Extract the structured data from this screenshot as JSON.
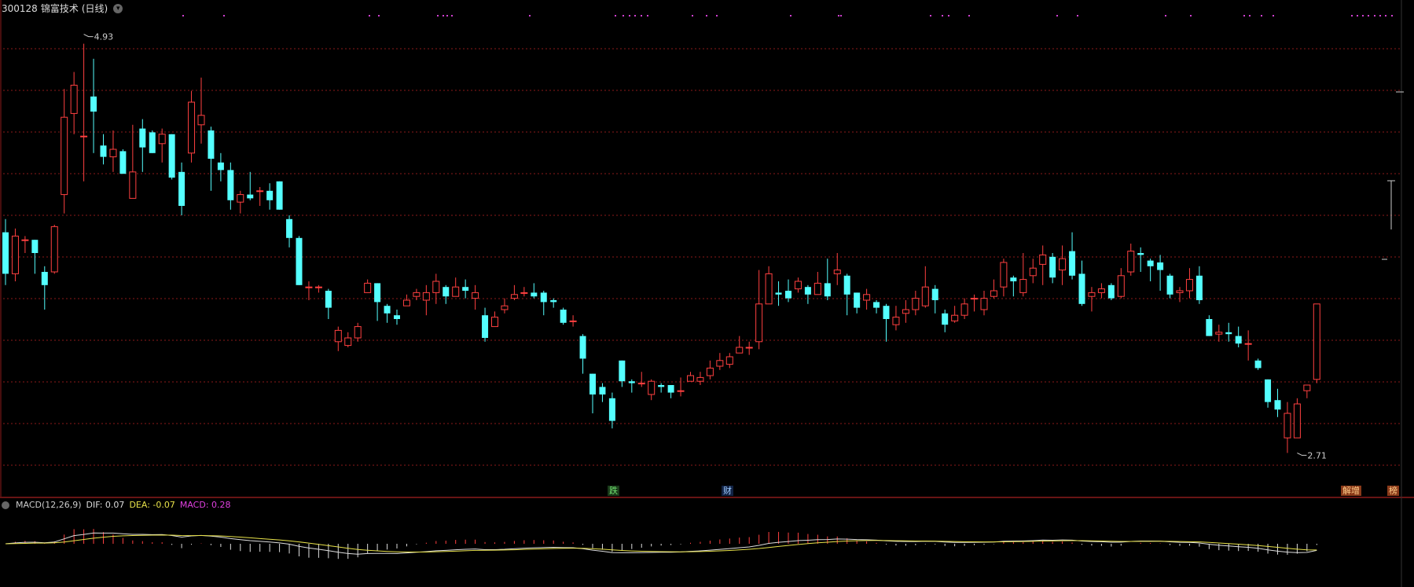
{
  "header": {
    "code": "300128",
    "name": "锦富技术",
    "period": "(日线)",
    "dropdown_icon": "chevron-down-icon"
  },
  "annotations": {
    "high_label": "4.93",
    "low_label": "2.71"
  },
  "event_tags": {
    "die": "跌",
    "cai": "财",
    "zeng": "解增",
    "wen": "榜"
  },
  "macd": {
    "label": "MACD(12,26,9)",
    "dif": "DIF: 0.07",
    "dea": "DEA: -0.07",
    "macd": "MACD: 0.28"
  },
  "colors": {
    "up": "#ff4040",
    "down": "#54ffff",
    "grid": "#8b1a1a",
    "dif": "#dddddd",
    "dea": "#e8e24a",
    "macd_hist_up": "#ff4040",
    "macd_hist_down": "#dddddd",
    "marker": "#d040d0"
  },
  "chart_data": {
    "type": "candlestick",
    "title": "300128 锦富技术(日线)",
    "price_high": 4.93,
    "price_low": 2.71,
    "candles": [
      [
        3.88,
        3.66,
        3.95,
        3.6
      ],
      [
        3.66,
        3.86,
        3.9,
        3.62
      ],
      [
        3.84,
        3.84,
        3.86,
        3.77
      ],
      [
        3.84,
        3.77,
        3.84,
        3.66
      ],
      [
        3.67,
        3.6,
        3.7,
        3.47
      ],
      [
        3.67,
        3.91,
        3.92,
        3.66
      ],
      [
        4.08,
        4.49,
        4.64,
        3.98
      ],
      [
        4.51,
        4.66,
        4.73,
        4.4
      ],
      [
        4.39,
        4.39,
        4.88,
        4.15
      ],
      [
        4.6,
        4.52,
        4.8,
        4.3
      ],
      [
        4.34,
        4.28,
        4.4,
        4.24
      ],
      [
        4.28,
        4.32,
        4.42,
        4.2
      ],
      [
        4.31,
        4.19,
        4.32,
        4.22
      ],
      [
        4.06,
        4.2,
        4.45,
        4.06
      ],
      [
        4.43,
        4.33,
        4.48,
        4.2
      ],
      [
        4.41,
        4.3,
        4.42,
        4.3
      ],
      [
        4.35,
        4.4,
        4.43,
        4.25
      ],
      [
        4.4,
        4.17,
        4.4,
        4.16
      ],
      [
        4.2,
        4.02,
        4.25,
        3.97
      ],
      [
        4.3,
        4.57,
        4.63,
        4.25
      ],
      [
        4.45,
        4.5,
        4.7,
        4.35
      ],
      [
        4.42,
        4.27,
        4.44,
        4.1
      ],
      [
        4.25,
        4.21,
        4.3,
        4.15
      ],
      [
        4.21,
        4.05,
        4.25,
        4.0
      ],
      [
        4.04,
        4.08,
        4.1,
        3.98
      ],
      [
        4.08,
        4.06,
        4.2,
        4.05
      ],
      [
        4.1,
        4.1,
        4.12,
        4.02
      ],
      [
        4.1,
        4.05,
        4.14,
        4.0
      ],
      [
        4.15,
        4.0,
        4.15,
        4.0
      ],
      [
        3.95,
        3.85,
        3.97,
        3.8
      ],
      [
        3.85,
        3.6,
        3.86,
        3.6
      ],
      [
        3.59,
        3.59,
        3.62,
        3.52
      ],
      [
        3.59,
        3.59,
        3.6,
        3.56
      ],
      [
        3.57,
        3.48,
        3.58,
        3.42
      ],
      [
        3.3,
        3.36,
        3.38,
        3.25
      ],
      [
        3.28,
        3.32,
        3.35,
        3.27
      ],
      [
        3.32,
        3.38,
        3.4,
        3.3
      ],
      [
        3.56,
        3.61,
        3.63,
        3.56
      ],
      [
        3.61,
        3.51,
        3.61,
        3.41
      ],
      [
        3.49,
        3.45,
        3.5,
        3.4
      ],
      [
        3.44,
        3.42,
        3.47,
        3.39
      ],
      [
        3.49,
        3.52,
        3.55,
        3.49
      ],
      [
        3.54,
        3.56,
        3.58,
        3.52
      ],
      [
        3.52,
        3.56,
        3.6,
        3.44
      ],
      [
        3.56,
        3.62,
        3.66,
        3.5
      ],
      [
        3.59,
        3.54,
        3.6,
        3.5
      ],
      [
        3.54,
        3.59,
        3.64,
        3.55
      ],
      [
        3.59,
        3.57,
        3.63,
        3.53
      ],
      [
        3.53,
        3.56,
        3.6,
        3.47
      ],
      [
        3.44,
        3.32,
        3.48,
        3.3
      ],
      [
        3.38,
        3.43,
        3.46,
        3.38
      ],
      [
        3.47,
        3.49,
        3.53,
        3.45
      ],
      [
        3.53,
        3.55,
        3.6,
        3.52
      ],
      [
        3.56,
        3.56,
        3.59,
        3.54
      ],
      [
        3.56,
        3.54,
        3.61,
        3.53
      ],
      [
        3.56,
        3.51,
        3.57,
        3.44
      ],
      [
        3.52,
        3.51,
        3.53,
        3.48
      ],
      [
        3.47,
        3.4,
        3.48,
        3.39
      ],
      [
        3.41,
        3.41,
        3.44,
        3.38
      ],
      [
        3.33,
        3.21,
        3.34,
        3.13
      ],
      [
        3.13,
        3.02,
        3.13,
        2.92
      ],
      [
        3.06,
        3.02,
        3.08,
        2.98
      ],
      [
        3.0,
        2.88,
        3.03,
        2.84
      ],
      [
        3.2,
        3.09,
        3.2,
        3.06
      ],
      [
        3.09,
        3.08,
        3.1,
        3.03
      ],
      [
        3.08,
        3.08,
        3.14,
        3.06
      ],
      [
        3.02,
        3.09,
        3.1,
        2.99
      ],
      [
        3.07,
        3.06,
        3.08,
        3.03
      ],
      [
        3.07,
        3.03,
        3.07,
        3.0
      ],
      [
        3.04,
        3.04,
        3.11,
        3.01
      ],
      [
        3.09,
        3.12,
        3.14,
        3.09
      ],
      [
        3.09,
        3.11,
        3.14,
        3.07
      ],
      [
        3.12,
        3.16,
        3.2,
        3.1
      ],
      [
        3.17,
        3.2,
        3.24,
        3.15
      ],
      [
        3.18,
        3.22,
        3.24,
        3.16
      ],
      [
        3.24,
        3.27,
        3.33,
        3.24
      ],
      [
        3.27,
        3.27,
        3.3,
        3.23
      ],
      [
        3.3,
        3.5,
        3.68,
        3.26
      ],
      [
        3.5,
        3.66,
        3.7,
        3.5
      ],
      [
        3.56,
        3.55,
        3.62,
        3.49
      ],
      [
        3.57,
        3.53,
        3.63,
        3.51
      ],
      [
        3.58,
        3.62,
        3.64,
        3.56
      ],
      [
        3.59,
        3.55,
        3.6,
        3.5
      ],
      [
        3.55,
        3.61,
        3.67,
        3.55
      ],
      [
        3.61,
        3.54,
        3.74,
        3.52
      ],
      [
        3.66,
        3.68,
        3.77,
        3.6
      ],
      [
        3.65,
        3.55,
        3.66,
        3.44
      ],
      [
        3.56,
        3.48,
        3.56,
        3.45
      ],
      [
        3.52,
        3.55,
        3.58,
        3.47
      ],
      [
        3.51,
        3.48,
        3.52,
        3.45
      ],
      [
        3.49,
        3.42,
        3.5,
        3.3
      ],
      [
        3.39,
        3.43,
        3.49,
        3.36
      ],
      [
        3.45,
        3.47,
        3.52,
        3.4
      ],
      [
        3.47,
        3.53,
        3.57,
        3.44
      ],
      [
        3.49,
        3.59,
        3.7,
        3.48
      ],
      [
        3.58,
        3.52,
        3.6,
        3.45
      ],
      [
        3.45,
        3.39,
        3.47,
        3.35
      ],
      [
        3.41,
        3.44,
        3.49,
        3.4
      ],
      [
        3.44,
        3.5,
        3.53,
        3.42
      ],
      [
        3.53,
        3.53,
        3.55,
        3.46
      ],
      [
        3.47,
        3.53,
        3.57,
        3.44
      ],
      [
        3.54,
        3.57,
        3.63,
        3.53
      ],
      [
        3.59,
        3.72,
        3.74,
        3.54
      ],
      [
        3.64,
        3.62,
        3.65,
        3.54
      ],
      [
        3.56,
        3.63,
        3.77,
        3.54
      ],
      [
        3.65,
        3.69,
        3.74,
        3.61
      ],
      [
        3.71,
        3.76,
        3.81,
        3.6
      ],
      [
        3.75,
        3.64,
        3.77,
        3.61
      ],
      [
        3.68,
        3.74,
        3.81,
        3.6
      ],
      [
        3.78,
        3.65,
        3.88,
        3.63
      ],
      [
        3.66,
        3.5,
        3.73,
        3.49
      ],
      [
        3.54,
        3.56,
        3.59,
        3.46
      ],
      [
        3.56,
        3.58,
        3.61,
        3.53
      ],
      [
        3.6,
        3.53,
        3.61,
        3.52
      ],
      [
        3.54,
        3.65,
        3.69,
        3.53
      ],
      [
        3.67,
        3.78,
        3.82,
        3.65
      ],
      [
        3.77,
        3.76,
        3.8,
        3.67
      ],
      [
        3.73,
        3.7,
        3.74,
        3.62
      ],
      [
        3.72,
        3.68,
        3.76,
        3.57
      ],
      [
        3.65,
        3.55,
        3.66,
        3.53
      ],
      [
        3.56,
        3.57,
        3.59,
        3.51
      ],
      [
        3.57,
        3.63,
        3.69,
        3.53
      ],
      [
        3.65,
        3.52,
        3.7,
        3.5
      ],
      [
        3.42,
        3.33,
        3.44,
        3.33
      ],
      [
        3.34,
        3.35,
        3.39,
        3.3
      ],
      [
        3.35,
        3.34,
        3.4,
        3.3
      ],
      [
        3.33,
        3.29,
        3.38,
        3.27
      ],
      [
        3.29,
        3.29,
        3.36,
        3.2
      ],
      [
        3.2,
        3.16,
        3.21,
        3.15
      ],
      [
        3.1,
        2.98,
        3.1,
        2.95
      ],
      [
        2.99,
        2.94,
        3.05,
        2.9
      ],
      [
        2.79,
        2.92,
        2.98,
        2.71
      ],
      [
        2.79,
        2.97,
        3.0,
        2.79
      ],
      [
        3.04,
        3.07,
        3.06,
        3.0
      ],
      [
        3.1,
        3.5,
        3.5,
        3.08
      ]
    ],
    "xlabel": "",
    "ylabel": ""
  }
}
